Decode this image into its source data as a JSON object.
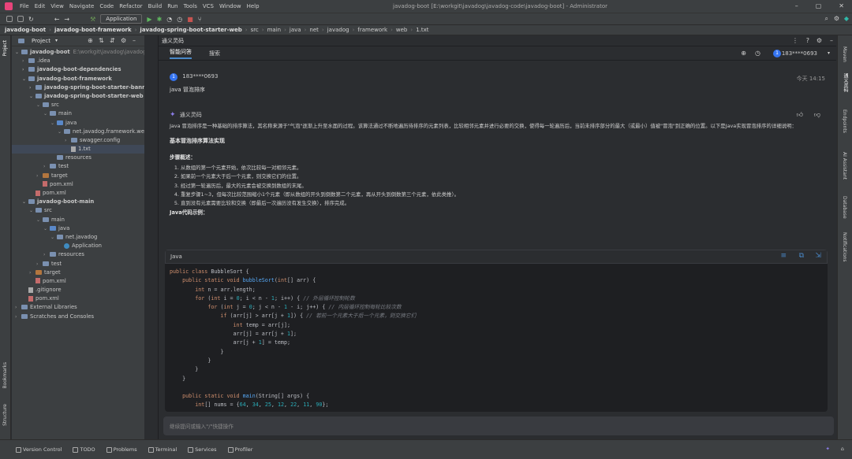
{
  "window": {
    "title": "javadog-boot [E:\\workgit\\javadog\\javadog-code\\javadog-boot] - Administrator",
    "menu": [
      "File",
      "Edit",
      "View",
      "Navigate",
      "Code",
      "Refactor",
      "Build",
      "Run",
      "Tools",
      "VCS",
      "Window",
      "Help"
    ]
  },
  "toolbar": {
    "run_config": "Application"
  },
  "breadcrumb": {
    "bold": [
      "javadog-boot",
      "javadog-boot-framework",
      "javadog-spring-boot-starter-web"
    ],
    "normal": [
      "src",
      "main",
      "java",
      "net",
      "javadog",
      "framework",
      "web",
      "1.txt"
    ]
  },
  "project": {
    "title": "Project",
    "tree": [
      {
        "label": "javadog-boot",
        "extra": "E:\\workgit\\javadog\\javadog-c",
        "indent": 0,
        "arrow": "⌄",
        "icon": "fold",
        "bold": true
      },
      {
        "label": ".idea",
        "indent": 1,
        "arrow": "›",
        "icon": "fold"
      },
      {
        "label": "javadog-boot-dependencies",
        "indent": 1,
        "arrow": "›",
        "icon": "fold",
        "bold": true
      },
      {
        "label": "javadog-boot-framework",
        "indent": 1,
        "arrow": "⌄",
        "icon": "fold",
        "bold": true
      },
      {
        "label": "javadog-spring-boot-starter-banner",
        "indent": 2,
        "arrow": "›",
        "icon": "fold",
        "bold": true
      },
      {
        "label": "javadog-spring-boot-starter-web",
        "indent": 2,
        "arrow": "⌄",
        "icon": "fold",
        "bold": true
      },
      {
        "label": "src",
        "indent": 3,
        "arrow": "⌄",
        "icon": "fold"
      },
      {
        "label": "main",
        "indent": 4,
        "arrow": "⌄",
        "icon": "fold"
      },
      {
        "label": "java",
        "indent": 5,
        "arrow": "⌄",
        "icon": "blue"
      },
      {
        "label": "net.javadog.framework.we",
        "indent": 6,
        "arrow": "⌄",
        "icon": "fold"
      },
      {
        "label": "swagger.config",
        "indent": 7,
        "arrow": "›",
        "icon": "fold"
      },
      {
        "label": "1.txt",
        "indent": 7,
        "arrow": "",
        "icon": "file",
        "sel": true
      },
      {
        "label": "resources",
        "indent": 5,
        "arrow": "",
        "icon": "fold"
      },
      {
        "label": "test",
        "indent": 4,
        "arrow": "›",
        "icon": "fold"
      },
      {
        "label": "target",
        "indent": 3,
        "arrow": "›",
        "icon": "orange"
      },
      {
        "label": "pom.xml",
        "indent": 3,
        "arrow": "",
        "icon": "m"
      },
      {
        "label": "pom.xml",
        "indent": 2,
        "arrow": "",
        "icon": "m"
      },
      {
        "label": "javadog-boot-main",
        "indent": 1,
        "arrow": "⌄",
        "icon": "fold",
        "bold": true
      },
      {
        "label": "src",
        "indent": 2,
        "arrow": "⌄",
        "icon": "fold"
      },
      {
        "label": "main",
        "indent": 3,
        "arrow": "⌄",
        "icon": "fold"
      },
      {
        "label": "java",
        "indent": 4,
        "arrow": "⌄",
        "icon": "blue"
      },
      {
        "label": "net.javadog",
        "indent": 5,
        "arrow": "⌄",
        "icon": "fold"
      },
      {
        "label": "Application",
        "indent": 6,
        "arrow": "",
        "icon": "class"
      },
      {
        "label": "resources",
        "indent": 4,
        "arrow": "›",
        "icon": "fold"
      },
      {
        "label": "test",
        "indent": 3,
        "arrow": "›",
        "icon": "fold"
      },
      {
        "label": "target",
        "indent": 2,
        "arrow": "›",
        "icon": "orange"
      },
      {
        "label": "pom.xml",
        "indent": 2,
        "arrow": "",
        "icon": "m"
      },
      {
        "label": ".gitignore",
        "indent": 1,
        "arrow": "",
        "icon": "file"
      },
      {
        "label": "pom.xml",
        "indent": 1,
        "arrow": "",
        "icon": "m"
      },
      {
        "label": "External Libraries",
        "indent": 0,
        "arrow": "›",
        "icon": "fold"
      },
      {
        "label": "Scratches and Consoles",
        "indent": 0,
        "arrow": "›",
        "icon": "fold"
      }
    ]
  },
  "left_stripe": {
    "top": "Project",
    "bottom1": "Bookmarks",
    "bottom2": "Structure"
  },
  "right_stripe": [
    "Maven",
    "通义灵码",
    "Endpoints",
    "AI Assistant",
    "Database",
    "Notifications"
  ],
  "panel": {
    "title": "通义灵码",
    "tabs": [
      "智能问答",
      "搜索"
    ],
    "user_name": "183****0693",
    "user_initial": "1"
  },
  "question": {
    "user": "183****0693",
    "time": "今天 14:15",
    "text": "java 冒泡排序"
  },
  "answer": {
    "bot_name": "通义灵码",
    "intro": "Java 冒泡排序是一种基础的排序算法，其名称来源于\"气泡\"逐渐上升至水面的过程。该算法通过不断地遍历待排序的元素列表，比较相邻元素并进行必要的交换，使得每一轮遍历后，当前未排序部分的最大（或最小）值被\"冒泡\"到正确的位置。以下是Java实现冒泡排序的详细说明：",
    "heading": "基本冒泡排序算法实现",
    "steps_title": "步骤概述：",
    "steps": [
      "从数组的第一个元素开始，依次比较每一对相邻元素。",
      "如果前一个元素大于后一个元素，则交换它们的位置。",
      "经过第一轮遍历后，最大的元素会被交换到数组的末尾。",
      "重复步骤1~3，但每次比较范围缩小1个元素（即从数组的开头到倒数第二个元素，再从开头到倒数第三个元素，依此类推）。",
      "直到没有元素需要比较和交换（即最后一次遍历没有发生交换），排序完成。"
    ],
    "code_title": "Java代码示例：",
    "code_lang": "Java"
  },
  "input": {
    "placeholder": "继续提问或输入\"/\"快捷操作"
  },
  "statusbar": [
    "Version Control",
    "TODO",
    "Problems",
    "Terminal",
    "Services",
    "Profiler"
  ]
}
